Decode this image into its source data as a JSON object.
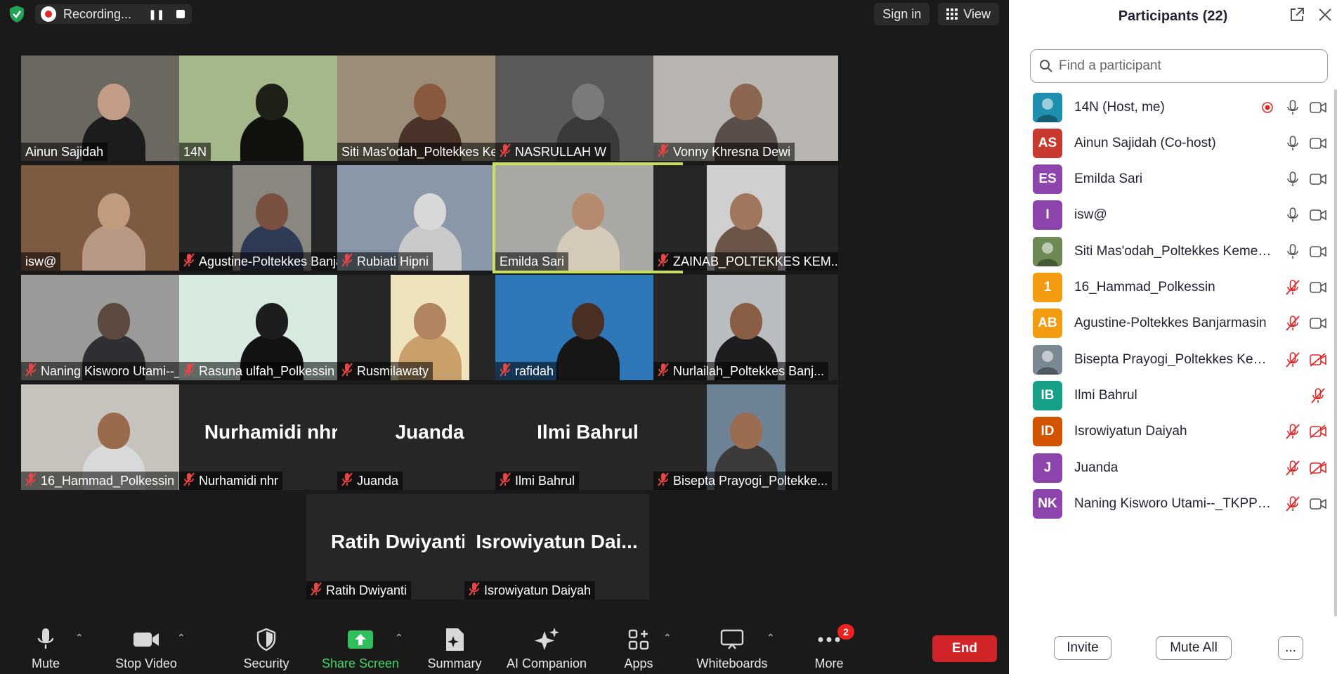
{
  "topbar": {
    "recording_label": "Recording...",
    "sign_in_label": "Sign in",
    "view_label": "View"
  },
  "tiles": [
    {
      "name": "Ainun Sajidah",
      "muted": false,
      "video": true,
      "bg": "#6b6860",
      "skin": "#c29c86",
      "cloth": "#1c1c1c",
      "active": false,
      "speaking": true
    },
    {
      "name": "14N",
      "muted": false,
      "video": true,
      "bg": "#a4b88a",
      "skin": "#1d2016",
      "cloth": "#0f110c",
      "active": false
    },
    {
      "name": "Siti Mas'odah_Poltekkes Kem...",
      "muted": false,
      "video": true,
      "bg": "#9c8d78",
      "skin": "#8a5a3f",
      "cloth": "#4a3328",
      "active": false
    },
    {
      "name": "NASRULLAH W",
      "muted": true,
      "video": true,
      "bg": "#5c5a58",
      "skin": "#7a7a78",
      "cloth": "#3a3a3a",
      "active": false
    },
    {
      "name": "Vonny Khresna Dewi",
      "muted": true,
      "video": true,
      "bg": "#b8b5b0",
      "skin": "#8c6650",
      "cloth": "#5a4e4a",
      "active": false
    },
    {
      "name": "isw@",
      "muted": false,
      "video": true,
      "bg": "#7e5a40",
      "skin": "#c29a7e",
      "cloth": "#b89784",
      "active": false
    },
    {
      "name": "Agustine-Poltekkes Banja...",
      "muted": true,
      "video": true,
      "narrow": true,
      "bg": "#8a8680",
      "skin": "#7a5040",
      "cloth": "#2f3a55",
      "active": false
    },
    {
      "name": "Rubiati Hipni",
      "muted": true,
      "video": true,
      "bg": "#8a97a8",
      "skin": "#d8d8d8",
      "cloth": "#c9c9c9",
      "active": false
    },
    {
      "name": "Emilda Sari",
      "muted": false,
      "video": true,
      "bg": "#a8a8a4",
      "skin": "#b68a6e",
      "cloth": "#d5c9b9",
      "active": true
    },
    {
      "name": "ZAINAB_POLTEKKES KEM...",
      "muted": true,
      "video": true,
      "narrow": true,
      "bg": "#cfcfcf",
      "skin": "#a0765c",
      "cloth": "#6b5548",
      "active": false
    },
    {
      "name": "Naning Kisworo Utami--_...",
      "muted": true,
      "video": true,
      "bg": "#9a9a98",
      "skin": "#5c4a40",
      "cloth": "#2f2f33",
      "active": false
    },
    {
      "name": "Rasuna ulfah_Polkessin",
      "muted": true,
      "video": true,
      "bg": "#d6eadf",
      "skin": "#1d1d1d",
      "cloth": "#121212",
      "active": false
    },
    {
      "name": "Rusmilawaty",
      "muted": true,
      "video": true,
      "narrow": true,
      "bg": "#efe3bd",
      "skin": "#b08560",
      "cloth": "#c9a06a",
      "active": false
    },
    {
      "name": "rafidah",
      "muted": true,
      "video": true,
      "bg": "#2e77b8",
      "skin": "#4a3024",
      "cloth": "#161616",
      "active": false
    },
    {
      "name": "Nurlailah_Poltekkes Banj...",
      "muted": true,
      "video": true,
      "narrow": true,
      "bg": "#b9bcc0",
      "skin": "#8a5e44",
      "cloth": "#1d1d1f",
      "active": false
    },
    {
      "name": "16_Hammad_Polkessin",
      "muted": true,
      "video": true,
      "bg": "#c6c3bc",
      "skin": "#9a6a4c",
      "cloth": "#d9d9d9",
      "active": false
    },
    {
      "name": "Nurhamidi nhr",
      "muted": true,
      "video": false,
      "display": "Nurhamidi nhr",
      "active": false
    },
    {
      "name": "Juanda",
      "muted": true,
      "video": false,
      "display": "Juanda",
      "active": false
    },
    {
      "name": "Ilmi Bahrul",
      "muted": true,
      "video": false,
      "display": "Ilmi Bahrul",
      "active": false
    },
    {
      "name": "Bisepta Prayogi_Poltekke...",
      "muted": true,
      "video": true,
      "narrow": true,
      "bg": "#6e8295",
      "skin": "#9a6c50",
      "cloth": "#3c3a3a",
      "active": false
    },
    {
      "name": "Ratih Dwiyanti",
      "muted": true,
      "video": false,
      "display": "Ratih Dwiyanti",
      "active": false
    },
    {
      "name": "Isrowiyatun Daiyah",
      "muted": true,
      "video": false,
      "display": "Isrowiyatun  Dai...",
      "active": false
    }
  ],
  "toolbar": {
    "mute_label": "Mute",
    "stop_video_label": "Stop Video",
    "security_label": "Security",
    "share_screen_label": "Share Screen",
    "summary_label": "Summary",
    "ai_companion_label": "AI Companion",
    "apps_label": "Apps",
    "whiteboards_label": "Whiteboards",
    "more_label": "More",
    "more_badge": "2",
    "end_label": "End"
  },
  "panel": {
    "title": "Participants (22)",
    "search_placeholder": "Find a participant",
    "invite_label": "Invite",
    "mute_all_label": "Mute All",
    "more_label": "...",
    "participants": [
      {
        "name": "14N (Host, me)",
        "initials": "",
        "color": "#1f8fb0",
        "photo": true,
        "recording": true,
        "mic": "on",
        "cam": "on"
      },
      {
        "name": "Ainun Sajidah (Co-host)",
        "initials": "AS",
        "color": "#c8392f",
        "mic": "on",
        "cam": "on"
      },
      {
        "name": "Emilda Sari",
        "initials": "ES",
        "color": "#8e44ad",
        "mic": "on",
        "cam": "on"
      },
      {
        "name": "isw@",
        "initials": "I",
        "color": "#8e44ad",
        "mic": "on",
        "cam": "on"
      },
      {
        "name": "Siti Mas'odah_Poltekkes Kemen...",
        "initials": "",
        "color": "#6d8a55",
        "photo": true,
        "mic": "on",
        "cam": "on"
      },
      {
        "name": "16_Hammad_Polkessin",
        "initials": "1",
        "color": "#f39c12",
        "mic": "off",
        "cam": "on"
      },
      {
        "name": "Agustine-Poltekkes Banjarmasin",
        "initials": "AB",
        "color": "#f39c12",
        "mic": "off",
        "cam": "on"
      },
      {
        "name": "Bisepta Prayogi_Poltekkes Kem...",
        "initials": "",
        "color": "#7a8894",
        "photo": true,
        "mic": "off",
        "cam": "off"
      },
      {
        "name": "Ilmi Bahrul",
        "initials": "IB",
        "color": "#16a085",
        "mic": "off",
        "cam": "none"
      },
      {
        "name": "Isrowiyatun Daiyah",
        "initials": "ID",
        "color": "#d35400",
        "mic": "off",
        "cam": "off"
      },
      {
        "name": "Juanda",
        "initials": "J",
        "color": "#8e44ad",
        "mic": "off",
        "cam": "off"
      },
      {
        "name": "Naning Kisworo Utami--_TKPP_...",
        "initials": "NK",
        "color": "#8e44ad",
        "mic": "off",
        "cam": "on"
      }
    ]
  }
}
